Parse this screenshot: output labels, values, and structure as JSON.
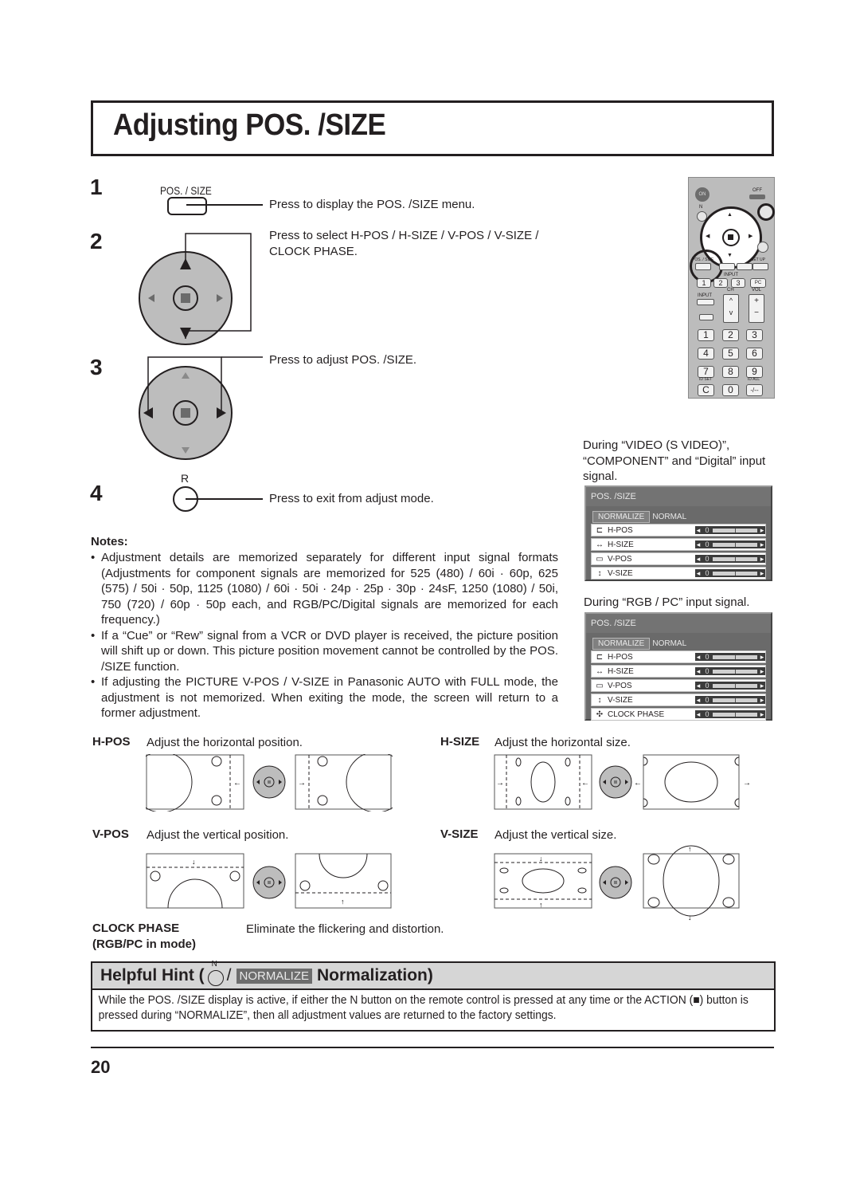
{
  "page": {
    "title": "Adjusting POS. /SIZE",
    "page_number": "20"
  },
  "steps": [
    {
      "number": "1",
      "button_label": "POS. / SIZE",
      "text": "Press to display the POS. /SIZE menu."
    },
    {
      "number": "2",
      "text_line1": "Press to select H-POS / H-SIZE / V-POS / V-SIZE /",
      "text_line2": "CLOCK PHASE."
    },
    {
      "number": "3",
      "text": "Press to adjust POS. /SIZE."
    },
    {
      "number": "4",
      "button_label": "R",
      "text": "Press to exit from adjust mode."
    }
  ],
  "notes": {
    "title": "Notes:",
    "items": [
      "Adjustment details are memorized separately for different input signal formats (Adjustments for component signals are memorized for 525 (480) / 60i · 60p, 625 (575) / 50i · 50p, 1125 (1080) / 60i · 50i · 24p · 25p · 30p · 24sF, 1250 (1080) / 50i, 750 (720) / 60p · 50p each, and RGB/PC/Digital signals are memorized for each frequency.)",
      "If a “Cue” or “Rew” signal from a VCR or DVD player is received, the picture position will shift up or down. This picture position movement cannot be controlled by the POS. /SIZE function.",
      "If adjusting the PICTURE V-POS / V-SIZE in Panasonic AUTO with FULL mode, the adjustment is not memorized. When exiting the mode, the screen will return to a former adjustment."
    ]
  },
  "remote": {
    "on": "ON",
    "off": "OFF",
    "n": "N",
    "r": "R",
    "pos_size": "POS. / SIZE",
    "set_up": "SET UP",
    "input_group": "INPUT",
    "inputs": [
      "1",
      "2",
      "3",
      "PC"
    ],
    "input": "INPUT",
    "ch": "CH",
    "vol": "VOL",
    "keypad": [
      "1",
      "2",
      "3",
      "4",
      "5",
      "6",
      "7",
      "8",
      "9",
      "C",
      "0",
      "-/--"
    ],
    "id_set": "ID SET",
    "id_all": "ID ALL"
  },
  "osd_video": {
    "caption": "During “VIDEO (S VIDEO)”, “COMPONENT” and “Digital” input signal.",
    "title": "POS. /SIZE",
    "normalize_label": "NORMALIZE",
    "normalize_value": "NORMAL",
    "rows": [
      {
        "icon": "h-pos-icon",
        "label": "H-POS",
        "value": "0",
        "level": 0.5
      },
      {
        "icon": "h-size-icon",
        "label": "H-SIZE",
        "value": "0",
        "level": 0.5
      },
      {
        "icon": "v-pos-icon",
        "label": "V-POS",
        "value": "0",
        "level": 0.5
      },
      {
        "icon": "v-size-icon",
        "label": "V-SIZE",
        "value": "0",
        "level": 0.5
      }
    ]
  },
  "osd_rgb": {
    "caption": "During “RGB / PC” input signal.",
    "title": "POS. /SIZE",
    "normalize_label": "NORMALIZE",
    "normalize_value": "NORMAL",
    "rows": [
      {
        "icon": "h-pos-icon",
        "label": "H-POS",
        "value": "0",
        "level": 0.5
      },
      {
        "icon": "h-size-icon",
        "label": "H-SIZE",
        "value": "0",
        "level": 0.5
      },
      {
        "icon": "v-pos-icon",
        "label": "V-POS",
        "value": "0",
        "level": 0.5
      },
      {
        "icon": "v-size-icon",
        "label": "V-SIZE",
        "value": "0",
        "level": 0.5
      },
      {
        "icon": "clock-phase-icon",
        "label": "CLOCK PHASE",
        "value": "0",
        "level": 0.5
      }
    ]
  },
  "functions": {
    "h_pos": {
      "label": "H-POS",
      "desc": "Adjust the horizontal position."
    },
    "h_size": {
      "label": "H-SIZE",
      "desc": "Adjust the horizontal size."
    },
    "v_pos": {
      "label": "V-POS",
      "desc": "Adjust the vertical position."
    },
    "v_size": {
      "label": "V-SIZE",
      "desc": "Adjust the vertical size."
    },
    "clock_phase": {
      "label": "CLOCK PHASE",
      "sublabel": "(RGB/PC in mode)",
      "desc": "Eliminate the flickering and distortion."
    }
  },
  "hint": {
    "prefix": "Helpful Hint (",
    "n_label": "N",
    "slash": "/",
    "normalize": "NORMALIZE",
    "suffix": "Normalization)",
    "body": "While the POS. /SIZE display is active, if either the N button on the remote control is pressed at any time or the ACTION (■) button is pressed during “NORMALIZE”, then all adjustment values are returned to the factory settings."
  }
}
